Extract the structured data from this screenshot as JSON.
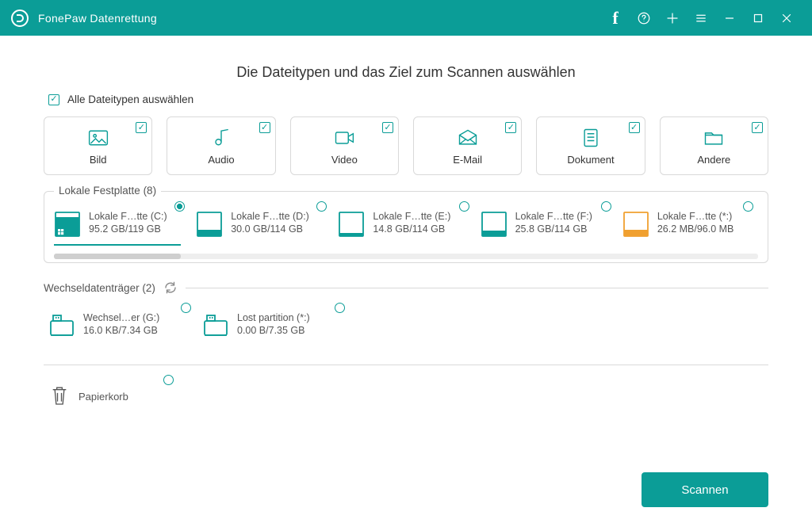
{
  "app": {
    "title": "FonePaw Datenrettung"
  },
  "heading": "Die Dateitypen und das Ziel zum Scannen auswählen",
  "selectAll": "Alle Dateitypen auswählen",
  "types": {
    "image": "Bild",
    "audio": "Audio",
    "video": "Video",
    "email": "E-Mail",
    "document": "Dokument",
    "other": "Andere"
  },
  "sections": {
    "local": {
      "title": "Lokale Festplatte (8)"
    },
    "removable": {
      "title": "Wechseldatenträger (2)"
    },
    "trash": {
      "label": "Papierkorb"
    }
  },
  "localDrives": [
    {
      "name": "Lokale F…tte (C:)",
      "size": "95.2 GB/119 GB",
      "color": "teal",
      "fill": 80,
      "selected": true,
      "os": true
    },
    {
      "name": "Lokale F…tte (D:)",
      "size": "30.0 GB/114 GB",
      "color": "teal",
      "fill": 26,
      "selected": false,
      "os": false
    },
    {
      "name": "Lokale F…tte (E:)",
      "size": "14.8 GB/114 GB",
      "color": "teal",
      "fill": 13,
      "selected": false,
      "os": false
    },
    {
      "name": "Lokale F…tte (F:)",
      "size": "25.8 GB/114 GB",
      "color": "teal",
      "fill": 23,
      "selected": false,
      "os": false
    },
    {
      "name": "Lokale F…tte (*:)",
      "size": "26.2 MB/96.0 MB",
      "color": "orange",
      "fill": 27,
      "selected": false,
      "os": false
    }
  ],
  "removableDrives": [
    {
      "name": "Wechsel…er (G:)",
      "size": "16.0 KB/7.34 GB",
      "selected": false
    },
    {
      "name": "Lost partition (*:)",
      "size": "0.00  B/7.35 GB",
      "selected": false
    }
  ],
  "scanButton": "Scannen"
}
